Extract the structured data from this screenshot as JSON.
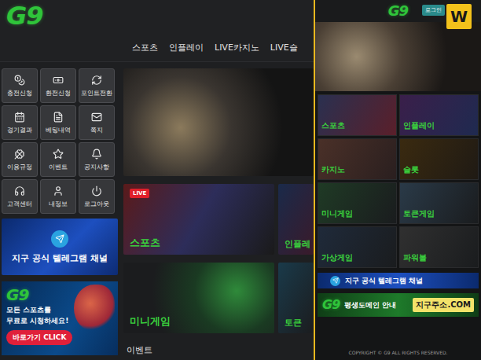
{
  "header": {
    "logo": "G9",
    "nav": [
      "스포츠",
      "인플레이",
      "LIVE카지노",
      "LIVE슬"
    ]
  },
  "quick_menu": [
    "충전신청",
    "환전신청",
    "포인트전환",
    "경기결과",
    "베팅내역",
    "쪽지",
    "이용규정",
    "이벤트",
    "공지사항",
    "고객센터",
    "내정보",
    "로그아웃"
  ],
  "side_banners": {
    "telegram": "지구 공식 텔레그램 채널",
    "promo": {
      "logo": "G9",
      "line1": "모든 스포츠를",
      "line2": "무료로 시청하세요!",
      "button": "바로가기 CLICK"
    }
  },
  "game_cards": [
    {
      "label": "스포츠",
      "badge": "LIVE"
    },
    {
      "label": "인플레",
      "badge": ""
    },
    {
      "label": "미니게임",
      "badge": ""
    },
    {
      "label": "토큰",
      "badge": ""
    }
  ],
  "section_title": "이벤트",
  "mobile": {
    "logo": "G9",
    "login": "로그인",
    "watermark": "W",
    "tiles": [
      "스포츠",
      "인플레이",
      "카지노",
      "슬롯",
      "미니게임",
      "토큰게임",
      "가상게임",
      "파워볼"
    ],
    "telegram": "지구 공식 텔레그램 채널",
    "domain": {
      "logo": "G9",
      "title": "평생도메인 안내",
      "address": "지구주소.COM"
    },
    "copyright": "COPYRIGHT © G9 ALL RIGHTS RESERVED."
  }
}
